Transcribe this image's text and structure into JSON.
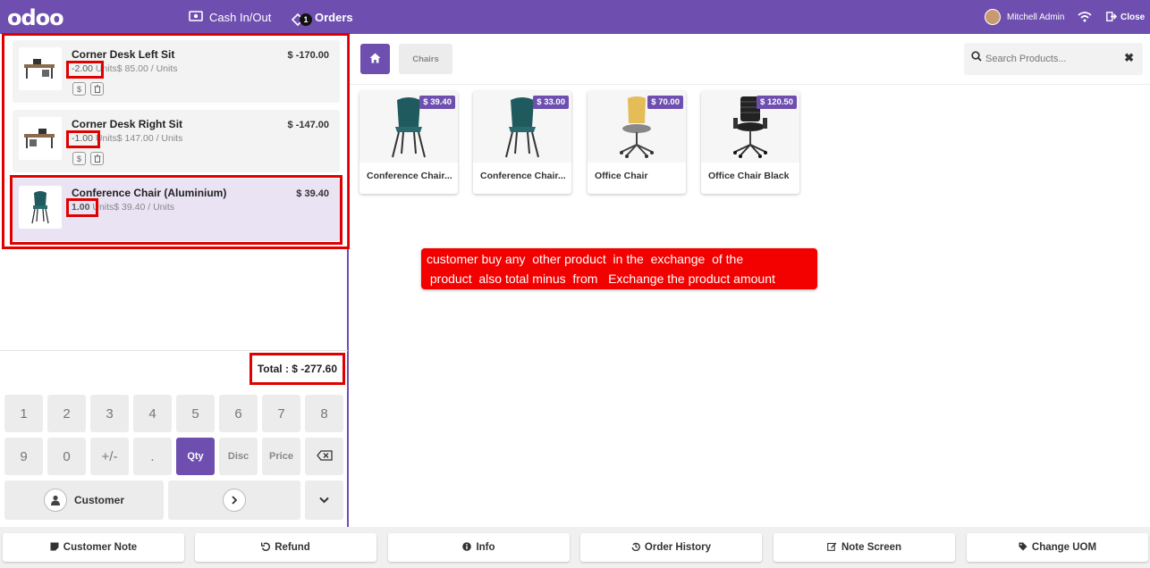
{
  "topbar": {
    "logo": "odoo",
    "cash_label": "Cash In/Out",
    "orders_label": "Orders",
    "orders_badge": "1",
    "user_name": "Mitchell Admin",
    "close_label": "Close"
  },
  "order_lines": [
    {
      "name": "Corner Desk Left Sit",
      "price": "$ -170.00",
      "qty": "-2.00",
      "unit_text": "Units$ 85.00 / Units"
    },
    {
      "name": "Corner Desk Right Sit",
      "price": "$ -147.00",
      "qty": "-1.00",
      "unit_text": "Units$ 147.00 / Units"
    },
    {
      "name": "Conference Chair (Aluminium)",
      "price": "$ 39.40",
      "qty": "1.00",
      "unit_text": "Units$ 39.40 / Units"
    }
  ],
  "total": "Total : $ -277.60",
  "numpad": {
    "row1": [
      "1",
      "2",
      "3",
      "4",
      "5",
      "6",
      "7",
      "8"
    ],
    "row2": [
      "9",
      "0",
      "+/-",
      ".",
      "Qty",
      "Disc",
      "Price"
    ],
    "customer_label": "Customer"
  },
  "products_header": {
    "category": "Chairs",
    "search_placeholder": "Search Products..."
  },
  "products": [
    {
      "name": "Conference Chair...",
      "price": "$ 39.40"
    },
    {
      "name": "Conference Chair...",
      "price": "$ 33.00"
    },
    {
      "name": "Office Chair",
      "price": "$ 70.00"
    },
    {
      "name": "Office Chair Black",
      "price": "$ 120.50"
    }
  ],
  "annotation": "customer buy any  other product  in the  exchange  of the\n product  also total minus  from   Exchange the product amount",
  "bottom_buttons": [
    "Customer Note",
    "Refund",
    "Info",
    "Order History",
    "Note Screen",
    "Change UOM"
  ],
  "colors": {
    "accent": "#6e4fb0",
    "highlight": "#e00000"
  }
}
